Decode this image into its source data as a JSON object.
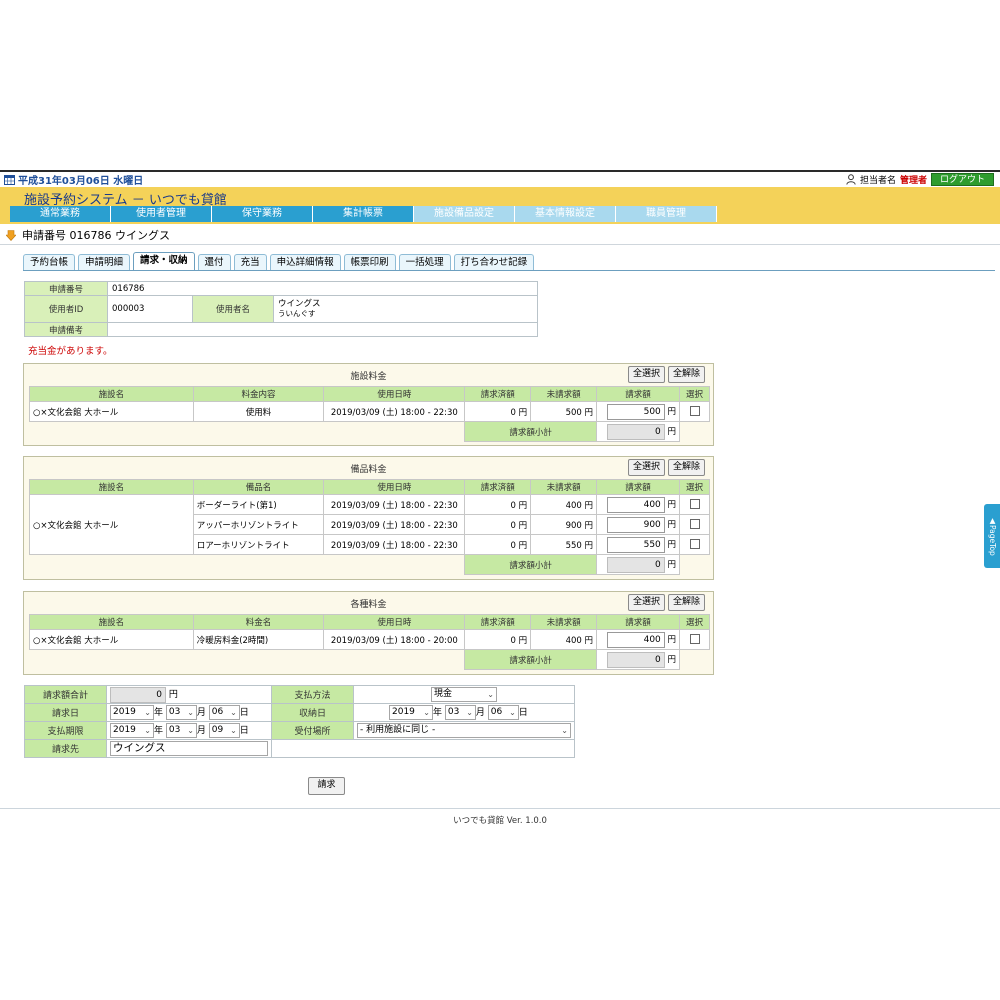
{
  "topbar": {
    "date": "平成31年03月06日 水曜日",
    "user_label": "担当者名",
    "role": "管理者",
    "logout": "ログアウト"
  },
  "header": {
    "title": "施設予約システム － いつでも貸館",
    "menu": [
      {
        "label": "通常業務"
      },
      {
        "label": "使用者管理"
      },
      {
        "label": "保守業務"
      },
      {
        "label": "集計帳票"
      },
      {
        "label": "施設備品設定"
      },
      {
        "label": "基本情報設定"
      },
      {
        "label": "職員管理"
      }
    ]
  },
  "heading": "申請番号 016786 ウイングス",
  "tabs": [
    {
      "label": "予約台帳"
    },
    {
      "label": "申請明細"
    },
    {
      "label": "請求・収納"
    },
    {
      "label": "還付"
    },
    {
      "label": "充当"
    },
    {
      "label": "申込詳細情報"
    },
    {
      "label": "帳票印刷"
    },
    {
      "label": "一括処理"
    },
    {
      "label": "打ち合わせ記録"
    }
  ],
  "info": {
    "app_no_label": "申請番号",
    "app_no": "016786",
    "user_id_label": "使用者ID",
    "user_id": "000003",
    "user_name_label": "使用者名",
    "user_name": "ウイングス",
    "user_kana": "ういんぐす",
    "app_memo_label": "申請備考",
    "app_memo": ""
  },
  "warning": "充当金があります。",
  "sections": {
    "facility": {
      "title": "施設料金",
      "select_all": "全選択",
      "clear_all": "全解除",
      "headers": [
        "施設名",
        "料金内容",
        "使用日時",
        "請求済額",
        "未請求額",
        "請求額",
        "選択"
      ],
      "rows": [
        {
          "facility": "○×文化会館 大ホール",
          "content": "使用料",
          "datetime": "2019/03/09 (土) 18:00 - 22:30",
          "billed": "0 円",
          "unbilled": "500 円",
          "amount": "500",
          "yen": "円"
        }
      ],
      "subtotal_label": "請求額小計",
      "subtotal": "0",
      "yen": "円"
    },
    "equipment": {
      "title": "備品料金",
      "select_all": "全選択",
      "clear_all": "全解除",
      "headers": [
        "施設名",
        "備品名",
        "使用日時",
        "請求済額",
        "未請求額",
        "請求額",
        "選択"
      ],
      "facility": "○×文化会館 大ホール",
      "rows": [
        {
          "item": "ボーダーライト(第1)",
          "datetime": "2019/03/09 (土) 18:00 - 22:30",
          "billed": "0 円",
          "unbilled": "400 円",
          "amount": "400",
          "yen": "円"
        },
        {
          "item": "アッパーホリゾントライト",
          "datetime": "2019/03/09 (土) 18:00 - 22:30",
          "billed": "0 円",
          "unbilled": "900 円",
          "amount": "900",
          "yen": "円"
        },
        {
          "item": "ロアーホリゾントライト",
          "datetime": "2019/03/09 (土) 18:00 - 22:30",
          "billed": "0 円",
          "unbilled": "550 円",
          "amount": "550",
          "yen": "円"
        }
      ],
      "subtotal_label": "請求額小計",
      "subtotal": "0",
      "yen": "円"
    },
    "misc": {
      "title": "各種料金",
      "select_all": "全選択",
      "clear_all": "全解除",
      "headers": [
        "施設名",
        "料金名",
        "使用日時",
        "請求済額",
        "未請求額",
        "請求額",
        "選択"
      ],
      "rows": [
        {
          "facility": "○×文化会館 大ホール",
          "content": "冷暖房料金(2時間)",
          "datetime": "2019/03/09 (土) 18:00 - 20:00",
          "billed": "0 円",
          "unbilled": "400 円",
          "amount": "400",
          "yen": "円"
        }
      ],
      "subtotal_label": "請求額小計",
      "subtotal": "0",
      "yen": "円"
    }
  },
  "form": {
    "total_label": "請求額合計",
    "total": "0",
    "yen": "円",
    "pay_method_label": "支払方法",
    "pay_method": "現金",
    "bill_date_label": "請求日",
    "bill_year": "2019",
    "bill_month": "03",
    "bill_day": "06",
    "deadline_label": "支払期限",
    "due_year": "2019",
    "due_month": "03",
    "due_day": "09",
    "pay_date_label": "収納日",
    "pay_year": "2019",
    "pay_month": "03",
    "pay_day": "06",
    "counter_label": "受付場所",
    "counter": "- 利用施設に同じ -",
    "payee_label": "請求先",
    "payee": "ウイングス",
    "year": "年",
    "month": "月",
    "day": "日"
  },
  "submit": "請求",
  "footer": "いつでも貸館 Ver. 1.0.0",
  "pagetop": "▲PageTop"
}
